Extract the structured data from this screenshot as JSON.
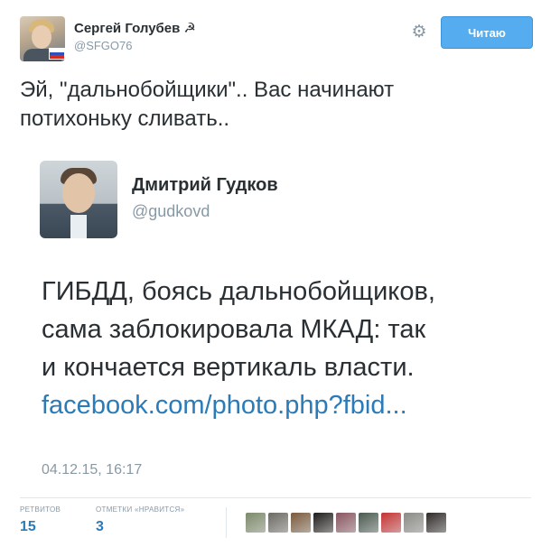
{
  "author": {
    "name": "Сергей Голубев",
    "symbol": "☭",
    "handle": "@SFGO76",
    "flag_colors": [
      "#ffffff",
      "#2a52be",
      "#d52b1e"
    ]
  },
  "actions": {
    "settings_icon": "gear-icon",
    "follow_label": "Читаю"
  },
  "tweet": {
    "line1": "Эй, \"дальнобойщики\".. Вас начинают",
    "line2": "потихоньку сливать.."
  },
  "quoted": {
    "name": "Дмитрий Гудков",
    "handle": "@gudkovd",
    "line1": "ГИБДД, боясь дальнобойщиков,",
    "line2": "сама заблокировала МКАД: так",
    "line3": "и кончается вертикаль власти.",
    "link": "facebook.com/photo.php?fbid...",
    "date": "04.12.15, 16:17"
  },
  "stats": {
    "retweets_label": "РЕТВИТОВ",
    "retweets_value": "15",
    "likes_label": "ОТМЕТКИ «НРАВИТСЯ»",
    "likes_value": "3"
  },
  "likers": [
    {
      "color": "#7c8a6a"
    },
    {
      "color": "#6b6a63"
    },
    {
      "color": "#7a5a3c"
    },
    {
      "color": "#1e1c1a"
    },
    {
      "color": "#8a5560"
    },
    {
      "color": "#4a5a50"
    },
    {
      "color": "#c83232"
    },
    {
      "color": "#8a8a86"
    },
    {
      "color": "#2e2a28"
    }
  ],
  "colors": {
    "accent": "#55acee",
    "link": "#2b7bb9",
    "muted": "#8899a6"
  }
}
